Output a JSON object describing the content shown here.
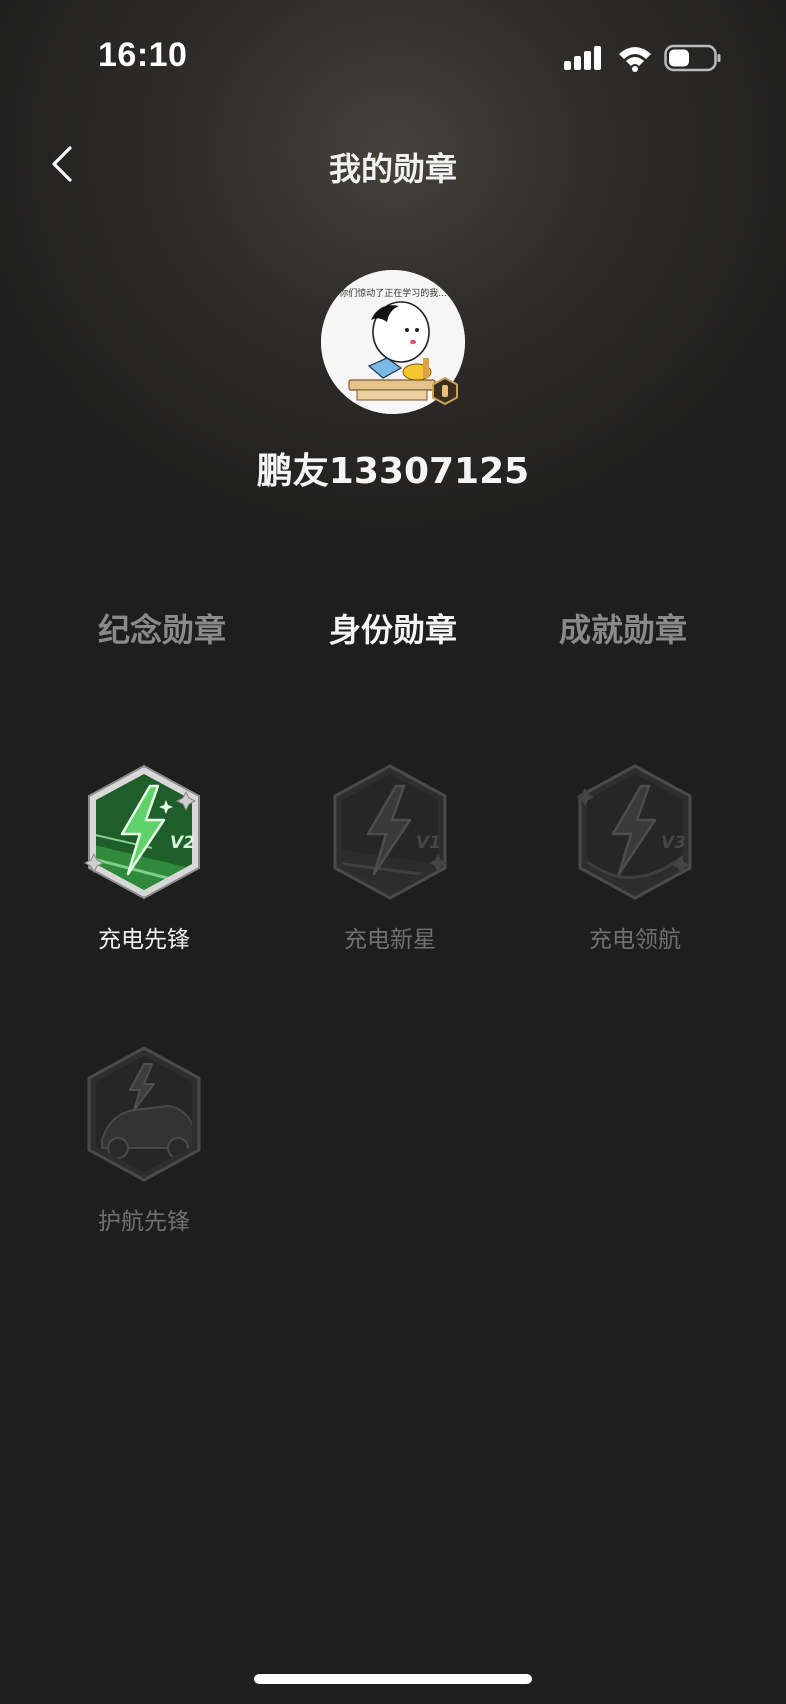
{
  "status_bar": {
    "time": "16:10",
    "icons": [
      "signal-icon",
      "wifi-icon",
      "battery-icon"
    ]
  },
  "header": {
    "title": "我的勋章",
    "back_icon": "chevron-left-icon"
  },
  "profile": {
    "avatar_caption": "你们惊动了正在学习的我...",
    "username": "鹏友13307125",
    "avatar_badge_icon": "hex-badge-icon"
  },
  "tabs": [
    {
      "label": "纪念勋章",
      "active": false
    },
    {
      "label": "身份勋章",
      "active": true
    },
    {
      "label": "成就勋章",
      "active": false
    }
  ],
  "badges": [
    {
      "label": "充电先锋",
      "level": "V2",
      "earned": true,
      "icon": "lightning-badge-icon"
    },
    {
      "label": "充电新星",
      "level": "V1",
      "earned": false,
      "icon": "lightning-badge-icon"
    },
    {
      "label": "充电领航",
      "level": "V3",
      "earned": false,
      "icon": "lightning-badge-icon"
    },
    {
      "label": "护航先锋",
      "level": "",
      "earned": false,
      "icon": "car-lightning-badge-icon"
    }
  ],
  "colors": {
    "background": "#1e1e1e",
    "earned_green": "#2e8b3e",
    "inactive_text": "#8a8a8a"
  }
}
